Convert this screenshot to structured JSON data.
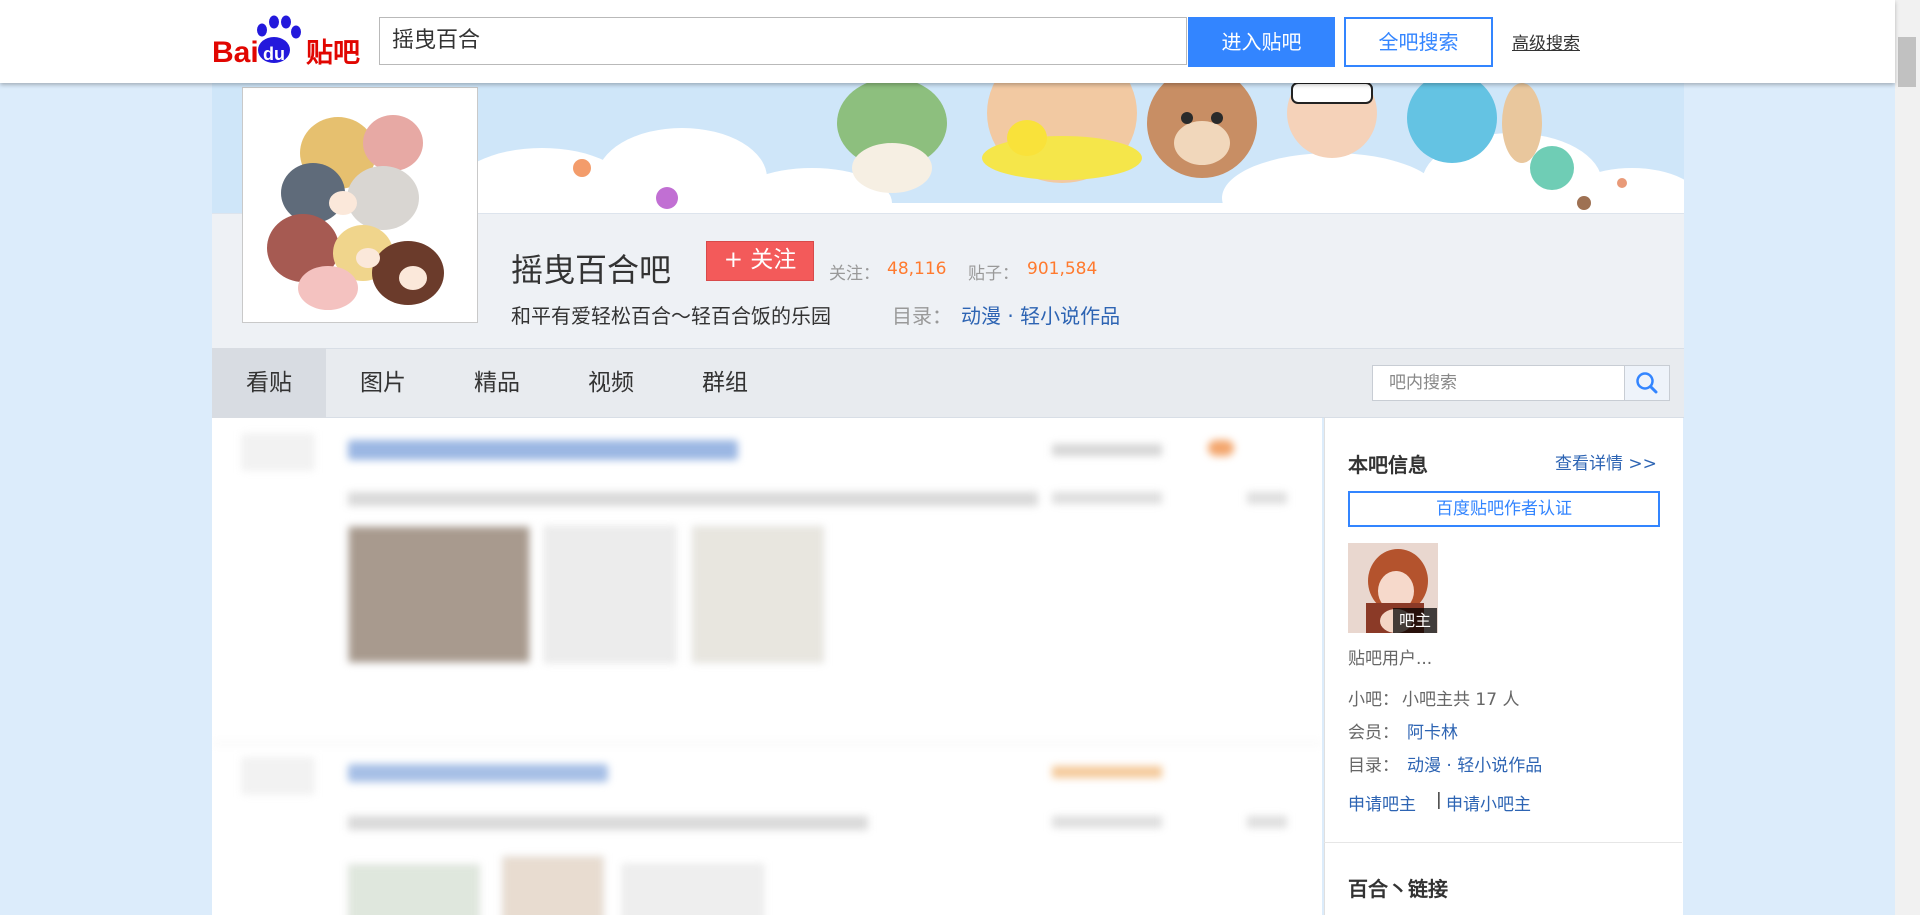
{
  "header": {
    "logo_text_left": "Bai",
    "logo_text_mid": "du",
    "logo_text_right": "贴吧",
    "search_value": "摇曳百合",
    "enter_button": "进入贴吧",
    "global_search_button": "全吧搜索",
    "advanced_search_link": "高级搜索"
  },
  "forum": {
    "name": "摇曳百合吧",
    "follow_button": "+ 关注",
    "followers_label": "关注：",
    "followers_value": "48,116",
    "posts_label": "贴子：",
    "posts_value": "901,584",
    "slogan": "和平有爱轻松百合～轻百合饭的乐园",
    "category_label": "目录：",
    "category_value": "动漫 · 轻小说作品"
  },
  "nav": {
    "tabs": [
      {
        "label": "看贴",
        "active": true
      },
      {
        "label": "图片",
        "active": false
      },
      {
        "label": "精品",
        "active": false
      },
      {
        "label": "视频",
        "active": false
      },
      {
        "label": "群组",
        "active": false
      }
    ],
    "inner_search_placeholder": "吧内搜索"
  },
  "sidebar": {
    "info_title": "本吧信息",
    "info_more": "查看详情 >>",
    "author_cert_button": "百度贴吧作者认证",
    "owner_badge": "吧主",
    "owner_name": "贴吧用户...",
    "small_owner_label": "小吧：",
    "small_owner_value": "小吧主共 17 人",
    "member_label": "会员：",
    "member_value": "阿卡林",
    "category_label": "目录：",
    "category_value": "动漫 · 轻小说作品",
    "apply_owner": "申请吧主",
    "apply_separator": "|",
    "apply_small_owner": "申请小吧主",
    "links_title": "百合丶链接"
  },
  "colors": {
    "brand_blue": "#3385ff",
    "link_blue": "#2d64b3",
    "follow_red": "#f35a5a",
    "stat_orange": "#ff7a2e",
    "page_bg": "#dcecfb"
  }
}
